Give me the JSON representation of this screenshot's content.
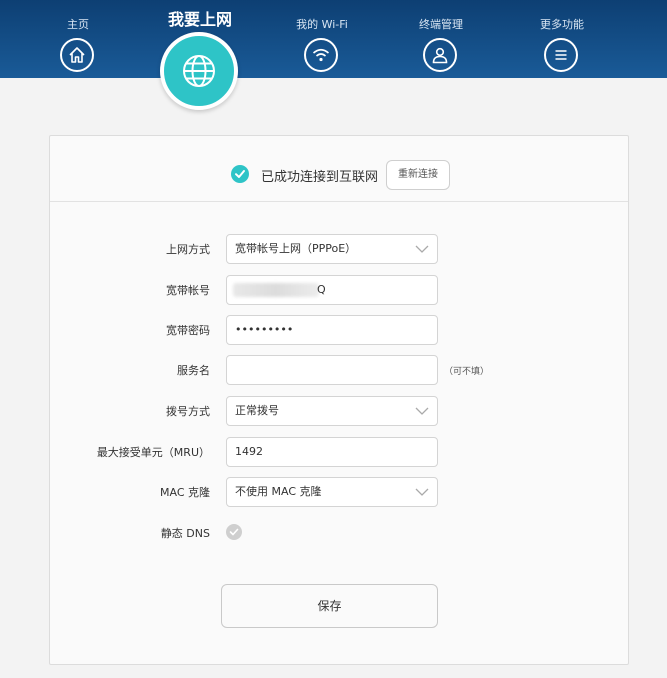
{
  "nav": {
    "items": [
      {
        "label": "主页",
        "icon": "home-icon"
      },
      {
        "label": "我的 Wi-Fi",
        "icon": "wifi-icon"
      },
      {
        "label": "终端管理",
        "icon": "user-icon"
      },
      {
        "label": "更多功能",
        "icon": "menu-icon"
      }
    ],
    "active": {
      "label": "我要上网",
      "icon": "globe-icon"
    }
  },
  "status": {
    "text": "已成功连接到互联网",
    "reconnect_label": "重新连接"
  },
  "form": {
    "connection_type": {
      "label": "上网方式",
      "value": "宽带帐号上网（PPPoE）"
    },
    "account": {
      "label": "宽带帐号",
      "value": "Q"
    },
    "password": {
      "label": "宽带密码",
      "value": "•••••••••"
    },
    "service_name": {
      "label": "服务名",
      "value": "",
      "note": "（可不填）"
    },
    "dial_mode": {
      "label": "拨号方式",
      "value": "正常拨号"
    },
    "mru": {
      "label": "最大接受单元（MRU）",
      "value": "1492"
    },
    "mac_clone": {
      "label": "MAC 克隆",
      "value": "不使用 MAC 克隆"
    },
    "static_dns": {
      "label": "静态 DNS",
      "checked": false
    }
  },
  "save_label": "保存",
  "colors": {
    "header": "#1a5b98",
    "accent": "#2ec4c7"
  }
}
